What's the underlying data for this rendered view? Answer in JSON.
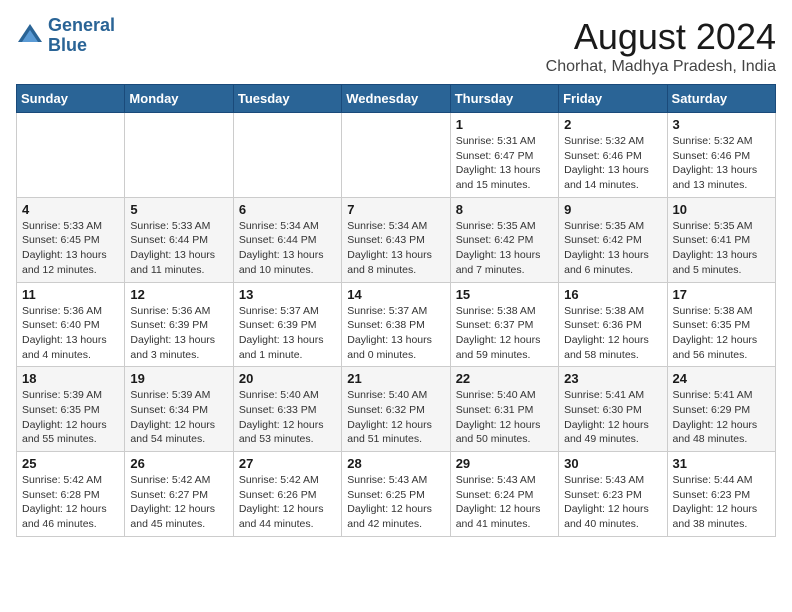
{
  "header": {
    "logo_line1": "General",
    "logo_line2": "Blue",
    "month": "August 2024",
    "location": "Chorhat, Madhya Pradesh, India"
  },
  "weekdays": [
    "Sunday",
    "Monday",
    "Tuesday",
    "Wednesday",
    "Thursday",
    "Friday",
    "Saturday"
  ],
  "weeks": [
    [
      {
        "day": "",
        "info": ""
      },
      {
        "day": "",
        "info": ""
      },
      {
        "day": "",
        "info": ""
      },
      {
        "day": "",
        "info": ""
      },
      {
        "day": "1",
        "info": "Sunrise: 5:31 AM\nSunset: 6:47 PM\nDaylight: 13 hours\nand 15 minutes."
      },
      {
        "day": "2",
        "info": "Sunrise: 5:32 AM\nSunset: 6:46 PM\nDaylight: 13 hours\nand 14 minutes."
      },
      {
        "day": "3",
        "info": "Sunrise: 5:32 AM\nSunset: 6:46 PM\nDaylight: 13 hours\nand 13 minutes."
      }
    ],
    [
      {
        "day": "4",
        "info": "Sunrise: 5:33 AM\nSunset: 6:45 PM\nDaylight: 13 hours\nand 12 minutes."
      },
      {
        "day": "5",
        "info": "Sunrise: 5:33 AM\nSunset: 6:44 PM\nDaylight: 13 hours\nand 11 minutes."
      },
      {
        "day": "6",
        "info": "Sunrise: 5:34 AM\nSunset: 6:44 PM\nDaylight: 13 hours\nand 10 minutes."
      },
      {
        "day": "7",
        "info": "Sunrise: 5:34 AM\nSunset: 6:43 PM\nDaylight: 13 hours\nand 8 minutes."
      },
      {
        "day": "8",
        "info": "Sunrise: 5:35 AM\nSunset: 6:42 PM\nDaylight: 13 hours\nand 7 minutes."
      },
      {
        "day": "9",
        "info": "Sunrise: 5:35 AM\nSunset: 6:42 PM\nDaylight: 13 hours\nand 6 minutes."
      },
      {
        "day": "10",
        "info": "Sunrise: 5:35 AM\nSunset: 6:41 PM\nDaylight: 13 hours\nand 5 minutes."
      }
    ],
    [
      {
        "day": "11",
        "info": "Sunrise: 5:36 AM\nSunset: 6:40 PM\nDaylight: 13 hours\nand 4 minutes."
      },
      {
        "day": "12",
        "info": "Sunrise: 5:36 AM\nSunset: 6:39 PM\nDaylight: 13 hours\nand 3 minutes."
      },
      {
        "day": "13",
        "info": "Sunrise: 5:37 AM\nSunset: 6:39 PM\nDaylight: 13 hours\nand 1 minute."
      },
      {
        "day": "14",
        "info": "Sunrise: 5:37 AM\nSunset: 6:38 PM\nDaylight: 13 hours\nand 0 minutes."
      },
      {
        "day": "15",
        "info": "Sunrise: 5:38 AM\nSunset: 6:37 PM\nDaylight: 12 hours\nand 59 minutes."
      },
      {
        "day": "16",
        "info": "Sunrise: 5:38 AM\nSunset: 6:36 PM\nDaylight: 12 hours\nand 58 minutes."
      },
      {
        "day": "17",
        "info": "Sunrise: 5:38 AM\nSunset: 6:35 PM\nDaylight: 12 hours\nand 56 minutes."
      }
    ],
    [
      {
        "day": "18",
        "info": "Sunrise: 5:39 AM\nSunset: 6:35 PM\nDaylight: 12 hours\nand 55 minutes."
      },
      {
        "day": "19",
        "info": "Sunrise: 5:39 AM\nSunset: 6:34 PM\nDaylight: 12 hours\nand 54 minutes."
      },
      {
        "day": "20",
        "info": "Sunrise: 5:40 AM\nSunset: 6:33 PM\nDaylight: 12 hours\nand 53 minutes."
      },
      {
        "day": "21",
        "info": "Sunrise: 5:40 AM\nSunset: 6:32 PM\nDaylight: 12 hours\nand 51 minutes."
      },
      {
        "day": "22",
        "info": "Sunrise: 5:40 AM\nSunset: 6:31 PM\nDaylight: 12 hours\nand 50 minutes."
      },
      {
        "day": "23",
        "info": "Sunrise: 5:41 AM\nSunset: 6:30 PM\nDaylight: 12 hours\nand 49 minutes."
      },
      {
        "day": "24",
        "info": "Sunrise: 5:41 AM\nSunset: 6:29 PM\nDaylight: 12 hours\nand 48 minutes."
      }
    ],
    [
      {
        "day": "25",
        "info": "Sunrise: 5:42 AM\nSunset: 6:28 PM\nDaylight: 12 hours\nand 46 minutes."
      },
      {
        "day": "26",
        "info": "Sunrise: 5:42 AM\nSunset: 6:27 PM\nDaylight: 12 hours\nand 45 minutes."
      },
      {
        "day": "27",
        "info": "Sunrise: 5:42 AM\nSunset: 6:26 PM\nDaylight: 12 hours\nand 44 minutes."
      },
      {
        "day": "28",
        "info": "Sunrise: 5:43 AM\nSunset: 6:25 PM\nDaylight: 12 hours\nand 42 minutes."
      },
      {
        "day": "29",
        "info": "Sunrise: 5:43 AM\nSunset: 6:24 PM\nDaylight: 12 hours\nand 41 minutes."
      },
      {
        "day": "30",
        "info": "Sunrise: 5:43 AM\nSunset: 6:23 PM\nDaylight: 12 hours\nand 40 minutes."
      },
      {
        "day": "31",
        "info": "Sunrise: 5:44 AM\nSunset: 6:23 PM\nDaylight: 12 hours\nand 38 minutes."
      }
    ]
  ]
}
